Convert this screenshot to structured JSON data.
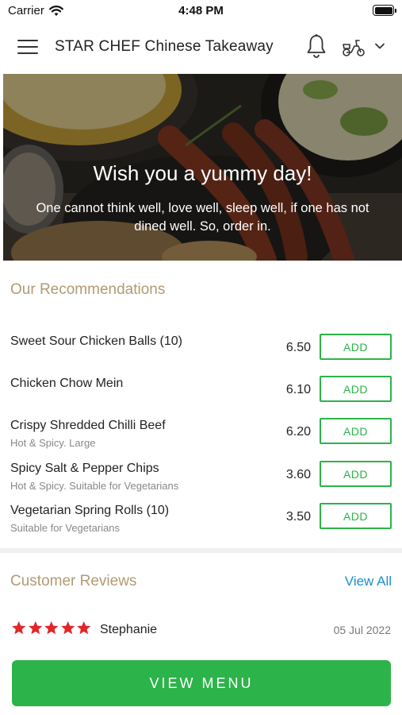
{
  "status_bar": {
    "carrier": "Carrier",
    "time": "4:48 PM"
  },
  "header": {
    "title": "STAR CHEF Chinese Takeaway",
    "icons": [
      "menu-icon",
      "bell-icon",
      "scooter-icon",
      "chevron-down-icon"
    ]
  },
  "hero": {
    "title": "Wish you a yummy day!",
    "subtitle": "One cannot think well, love well, sleep well, if one has not dined well. So, order in."
  },
  "recommendations": {
    "title": "Our Recommendations",
    "add_label": "ADD",
    "items": [
      {
        "name": "Sweet Sour Chicken Balls (10)",
        "desc": "",
        "price": "6.50"
      },
      {
        "name": "Chicken Chow Mein",
        "desc": "",
        "price": "6.10"
      },
      {
        "name": "Crispy Shredded Chilli Beef",
        "desc": "Hot & Spicy. Large",
        "price": "6.20"
      },
      {
        "name": "Spicy Salt & Pepper Chips",
        "desc": "Hot & Spicy. Suitable for Vegetarians",
        "price": "3.60"
      },
      {
        "name": "Vegetarian Spring Rolls (10)",
        "desc": "Suitable for Vegetarians",
        "price": "3.50"
      }
    ]
  },
  "reviews": {
    "title": "Customer Reviews",
    "view_all": "View All",
    "items": [
      {
        "rating": 5,
        "name": "Stephanie",
        "date": "05 Jul 2022"
      }
    ]
  },
  "cta": {
    "label": "VIEW MENU"
  },
  "colors": {
    "accent_green": "#2cb34a",
    "section_title": "#b29a73",
    "link_blue": "#1a8ed1",
    "star_red": "#e0262a"
  }
}
